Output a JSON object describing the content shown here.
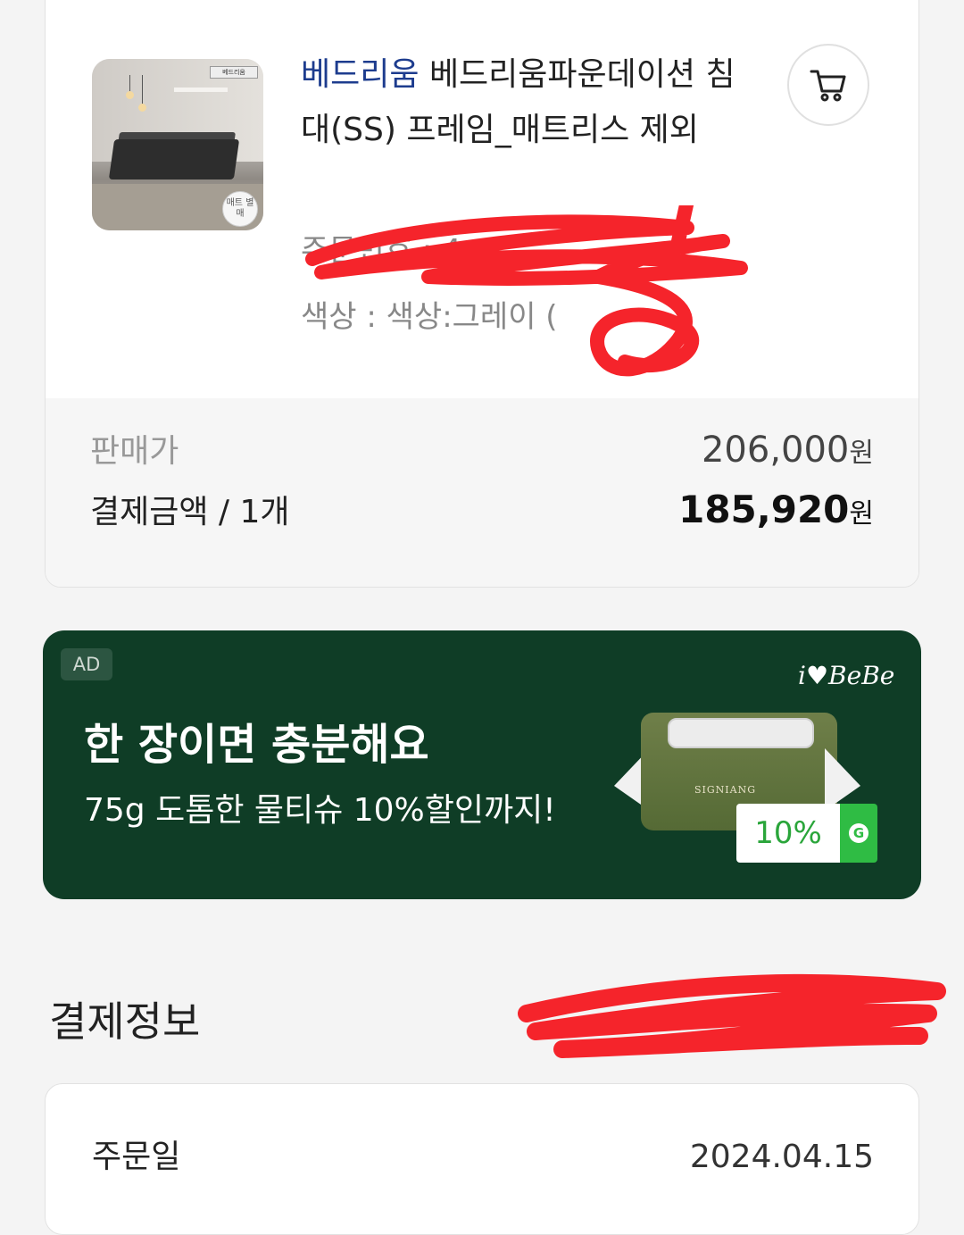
{
  "product": {
    "brand": "베드리움",
    "name": "베드리움파운데이션 침대(SS) 프레임_매트리스 제외",
    "option_order": "주문번호 : 4",
    "option_color": "색상 : 색상:그레이 (",
    "thumb_badge": "매트 별매",
    "thumb_tag": "베드리움",
    "cart_icon": "cart-icon"
  },
  "price": {
    "sale_label": "판매가",
    "sale_value": "206,000",
    "currency": "원",
    "pay_label": "결제금액 / 1개",
    "pay_value": "185,920"
  },
  "ad": {
    "label": "AD",
    "brand_logo": "i♥BeBe",
    "headline": "한 장이면 충분해요",
    "subtext": "75g 도톰한 물티슈 10%할인까지!",
    "discount": "10%",
    "badge": "G",
    "pack_text": "SIGNIANG"
  },
  "payment_info": {
    "section_title": "결제정보",
    "order_date_label": "주문일",
    "order_date_value": "2024.04.15"
  },
  "colors": {
    "brand_blue": "#1d3c8e",
    "ad_bg": "#0f3d26",
    "discount_green": "#2aa53a",
    "redaction": "#f5242b"
  }
}
